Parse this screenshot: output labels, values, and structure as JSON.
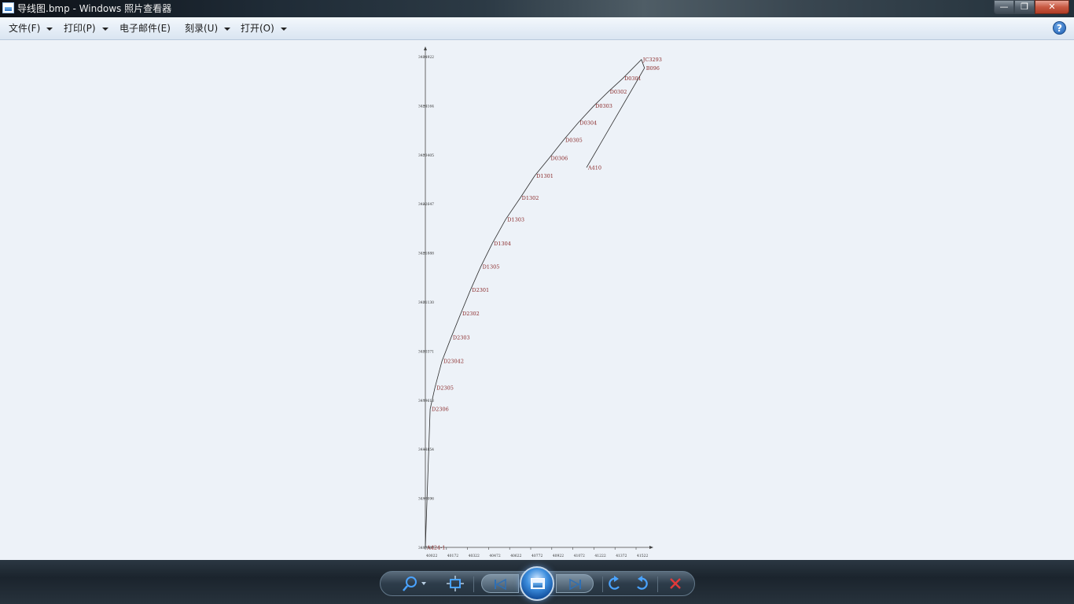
{
  "window": {
    "title": "导线图.bmp - Windows 照片查看器",
    "minimize_glyph": "—",
    "maximize_glyph": "❐",
    "close_glyph": "✕"
  },
  "menu": {
    "items": [
      {
        "label": "文件(F)",
        "has_dropdown": true
      },
      {
        "label": "打印(P)",
        "has_dropdown": true
      },
      {
        "label": "电子邮件(E)",
        "has_dropdown": false
      },
      {
        "label": "刻录(U)",
        "has_dropdown": true
      },
      {
        "label": "打开(O)",
        "has_dropdown": true
      }
    ],
    "help_glyph": "?"
  },
  "image": {
    "filename": "导线图.bmp",
    "line_color": "#2b2b2b",
    "label_color": "#8a2a2a",
    "traverse_points": [
      {
        "name": "A424-1",
        "x": 40022,
        "y": 3417337
      },
      {
        "name": "D2306",
        "x": 40045,
        "y": 3419690
      },
      {
        "name": "D2305",
        "x": 40068,
        "y": 3420051
      },
      {
        "name": "D23042",
        "x": 40102,
        "y": 3420505
      },
      {
        "name": "D2303",
        "x": 40147,
        "y": 3420912
      },
      {
        "name": "D2302",
        "x": 40193,
        "y": 3421318
      },
      {
        "name": "D2301",
        "x": 40240,
        "y": 3421717
      },
      {
        "name": "D1305",
        "x": 40290,
        "y": 3422117
      },
      {
        "name": "D1304",
        "x": 40345,
        "y": 3422508
      },
      {
        "name": "D1303",
        "x": 40410,
        "y": 3422919
      },
      {
        "name": "D1302",
        "x": 40480,
        "y": 3423283
      },
      {
        "name": "D1301",
        "x": 40550,
        "y": 3423660
      },
      {
        "name": "D0306",
        "x": 40620,
        "y": 3423961
      },
      {
        "name": "D0305",
        "x": 40690,
        "y": 3424271
      },
      {
        "name": "D0304",
        "x": 40760,
        "y": 3424561
      },
      {
        "name": "D0303",
        "x": 40835,
        "y": 3424848
      },
      {
        "name": "D0302",
        "x": 40905,
        "y": 3425088
      },
      {
        "name": "D0301",
        "x": 40975,
        "y": 3425316
      },
      {
        "name": "JC3293",
        "x": 41065,
        "y": 3425637
      },
      {
        "name": "B096",
        "x": 41080,
        "y": 3425492
      },
      {
        "name": "A410",
        "x": 40800,
        "y": 3423798
      }
    ],
    "x_ticks": [
      "40022",
      "40172",
      "40322",
      "40472",
      "40622",
      "40772",
      "40922",
      "41072",
      "41222",
      "41372",
      "41522"
    ],
    "y_ticks": [
      "3417337",
      "3418096",
      "3418854",
      "3419613",
      "3420371",
      "3421130",
      "3421888",
      "3422647",
      "3423405",
      "3424164",
      "3424922",
      "3425681"
    ],
    "x_range": [
      40022,
      41100
    ],
    "y_range": [
      3417337,
      3425700
    ]
  },
  "controls": [
    {
      "name": "zoom",
      "glyph": "⌕"
    },
    {
      "name": "actual-size",
      "glyph": "⛶"
    },
    {
      "name": "previous",
      "glyph": "⏮"
    },
    {
      "name": "slideshow",
      "glyph": ""
    },
    {
      "name": "next",
      "glyph": "⏭"
    },
    {
      "name": "rotate-ccw",
      "glyph": "↺"
    },
    {
      "name": "rotate-cw",
      "glyph": "↻"
    },
    {
      "name": "delete",
      "glyph": "✕"
    }
  ]
}
